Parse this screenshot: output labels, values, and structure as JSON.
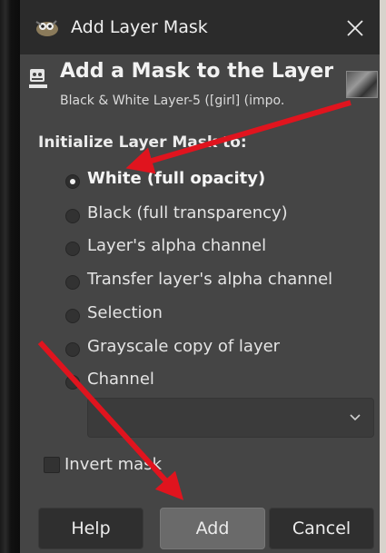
{
  "dialog": {
    "title": "Add Layer Mask",
    "header_title": "Add a Mask to the Layer",
    "header_subtitle": "Black & White Layer-5 ([girl] (impo."
  },
  "init": {
    "section_label": "Initialize Layer Mask to:",
    "options": [
      {
        "label": "White (full opacity)",
        "selected": true
      },
      {
        "label": "Black (full transparency)",
        "selected": false
      },
      {
        "label": "Layer's alpha channel",
        "selected": false
      },
      {
        "label": "Transfer layer's alpha channel",
        "selected": false
      },
      {
        "label": "Selection",
        "selected": false
      },
      {
        "label": "Grayscale copy of layer",
        "selected": false
      },
      {
        "label": "Channel",
        "selected": false
      }
    ],
    "channel_value": ""
  },
  "invert": {
    "label": "Invert mask",
    "checked": false
  },
  "buttons": {
    "help": "Help",
    "add": "Add",
    "cancel": "Cancel"
  },
  "colors": {
    "dialog_bg": "#454545",
    "titlebar_bg": "#2b2b2b",
    "annotation_arrow": "#e0141e"
  },
  "icons": {
    "app": "gimp-wilber-icon",
    "close": "close-icon",
    "mask": "layer-mask-icon",
    "dropdown": "chevron-down-icon"
  }
}
